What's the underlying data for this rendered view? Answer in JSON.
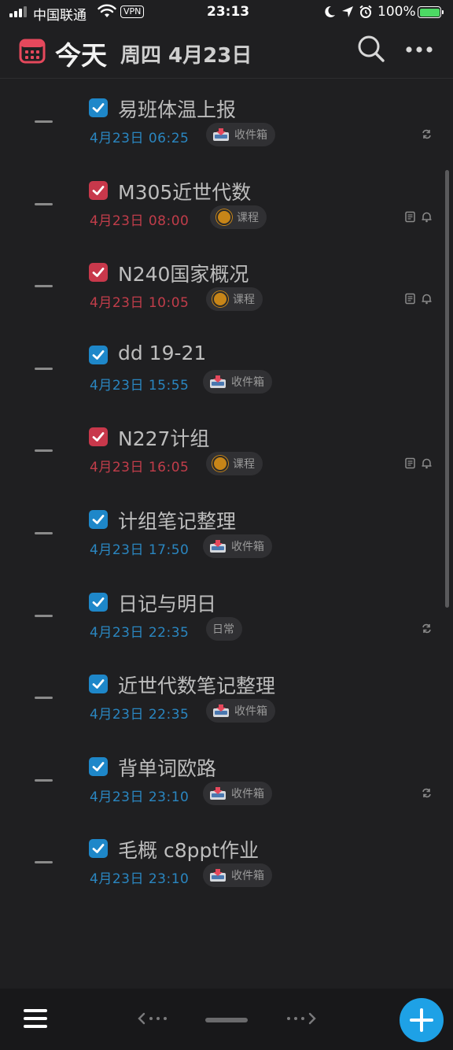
{
  "status_bar": {
    "carrier": "中国联通",
    "vpn": "VPN",
    "time": "23:13",
    "battery": "100%"
  },
  "header": {
    "title": "今天",
    "subtitle": "周四 4月23日"
  },
  "colors": {
    "blue": "#1e87c9",
    "red": "#c8384b",
    "blue_date": "#2a86c0",
    "red_date": "#c13d4a",
    "accent": "#1ea1e6"
  },
  "tasks": [
    {
      "title": "易班体温上报",
      "date": "4月23日 06:25",
      "tag": "收件箱",
      "tag_icon": "inbox-icon",
      "color": "blue",
      "icons": [
        "repeat-icon"
      ]
    },
    {
      "title": "M305近世代数",
      "date": "4月23日 08:00",
      "tag": "课程",
      "tag_icon": "orange-dot-icon",
      "color": "red",
      "icons": [
        "note-icon",
        "bell-icon"
      ]
    },
    {
      "title": "N240国家概况",
      "date": "4月23日 10:05",
      "tag": "课程",
      "tag_icon": "orange-dot-icon",
      "color": "red",
      "icons": [
        "note-icon",
        "bell-icon"
      ]
    },
    {
      "title": "dd 19-21",
      "date": "4月23日 15:55",
      "tag": "收件箱",
      "tag_icon": "inbox-icon",
      "color": "blue",
      "icons": []
    },
    {
      "title": "N227计组",
      "date": "4月23日 16:05",
      "tag": "课程",
      "tag_icon": "orange-dot-icon",
      "color": "red",
      "icons": [
        "note-icon",
        "bell-icon"
      ]
    },
    {
      "title": "计组笔记整理",
      "date": "4月23日 17:50",
      "tag": "收件箱",
      "tag_icon": "inbox-icon",
      "color": "blue",
      "icons": []
    },
    {
      "title": "日记与明日",
      "date": "4月23日 22:35",
      "tag": "日常",
      "tag_icon": "",
      "color": "blue",
      "icons": [
        "repeat-icon"
      ]
    },
    {
      "title": "近世代数笔记整理",
      "date": "4月23日 22:35",
      "tag": "收件箱",
      "tag_icon": "inbox-icon",
      "color": "blue",
      "icons": []
    },
    {
      "title": "背单词欧路",
      "date": "4月23日 23:10",
      "tag": "收件箱",
      "tag_icon": "inbox-icon",
      "color": "blue",
      "icons": [
        "repeat-icon"
      ]
    },
    {
      "title": "毛概 c8ppt作业",
      "date": "4月23日 23:10",
      "tag": "收件箱",
      "tag_icon": "inbox-icon",
      "color": "blue",
      "icons": []
    }
  ]
}
